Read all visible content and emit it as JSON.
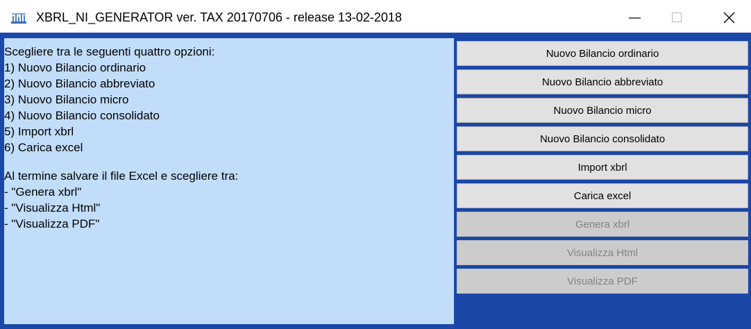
{
  "window": {
    "title": "XBRL_NI_GENERATOR ver. TAX 20170706 - release 13-02-2018",
    "icon": "app-icon",
    "controls": [
      "minimize-icon",
      "maximize-icon",
      "close-icon"
    ]
  },
  "instructions": {
    "lines": [
      "Scegliere tra le seguenti quattro opzioni:",
      "1) Nuovo Bilancio ordinario",
      "2) Nuovo Bilancio abbreviato",
      "3) Nuovo Bilancio micro",
      "4) Nuovo Bilancio consolidato",
      "5) Import xbrl",
      "6) Carica excel",
      "",
      "Al termine salvare il file Excel e scegliere tra:",
      "- \"Genera xbrl\"",
      "- \"Visualizza Html\"",
      "- \"Visualizza PDF\""
    ]
  },
  "buttons": [
    {
      "label": "Nuovo Bilancio ordinario",
      "enabled": true
    },
    {
      "label": "Nuovo Bilancio abbreviato",
      "enabled": true
    },
    {
      "label": "Nuovo Bilancio micro",
      "enabled": true
    },
    {
      "label": "Nuovo Bilancio consolidato",
      "enabled": true
    },
    {
      "label": "Import xbrl",
      "enabled": true
    },
    {
      "label": "Carica excel",
      "enabled": true
    },
    {
      "label": "Genera xbrl",
      "enabled": false
    },
    {
      "label": "Visualizza Html",
      "enabled": false
    },
    {
      "label": "Visualizza PDF",
      "enabled": false
    }
  ],
  "colors": {
    "panel_background": "#c2ddfa",
    "window_background": "#1a47a8",
    "button_background": "#e1e1e1",
    "button_disabled_background": "#cccccc",
    "button_disabled_text": "#838383"
  }
}
